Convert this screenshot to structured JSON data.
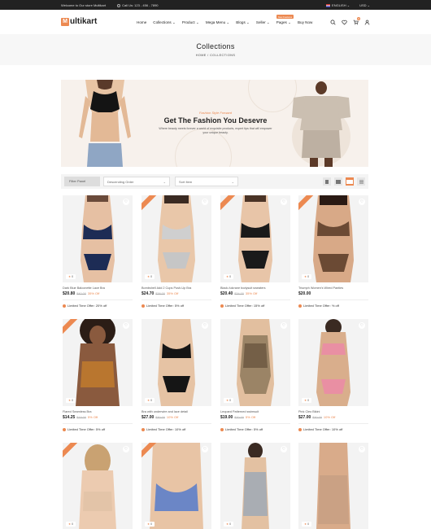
{
  "topbar": {
    "welcome": "Welcome to Our store Multikart",
    "phone": "Call Us: 123 - 456 - 7890",
    "language": "ENGLISH",
    "currency": "USD"
  },
  "header": {
    "logo_initial": "M",
    "logo_text": "ultikart",
    "nav": [
      "Home",
      "Collections",
      "Product",
      "Mega Menu",
      "Blogs",
      "Seller",
      "Pages",
      "Buy Now"
    ],
    "new_badge": "New Features",
    "cart_count": "0"
  },
  "page": {
    "title": "Collections",
    "breadcrumb": "HOME / COLLECTIONS"
  },
  "banner": {
    "tag": "Fashion Style Forward",
    "heading": "Get The Fashion You Desevre",
    "text": "Where beauty meets forever a world of exquisite products, expert tips that will empower your unique beauty."
  },
  "filters": {
    "filter_panel": "Filter Panel",
    "sort": "Descending Order",
    "items": "Sort Item"
  },
  "colors": {
    "accent": "#ec8951",
    "dark": "#222222"
  },
  "products": [
    {
      "name": "Dark Blue Balconette Lace Bra",
      "price": "$20.80",
      "old": "$40.00",
      "off": "35% Off",
      "offer": "Limited Time Offer: 20% off",
      "rating": "0",
      "sale": false
    },
    {
      "name": "Bombshell Add 2 Cups Push-Up Bra",
      "price": "$24.70",
      "old": "$38.00",
      "off": "35% Off",
      "offer": "Limited Time Offer: 5% off",
      "rating": "0",
      "sale": true
    },
    {
      "name": "Black-fulcrane bodysuit sweaters",
      "price": "$20.40",
      "old": "$34.00",
      "off": "35% Off",
      "offer": "Limited Time Offer: 15% off",
      "rating": "0",
      "sale": true
    },
    {
      "name": "Triumph Women's Wired Panties",
      "price": "$20.00",
      "old": "",
      "off": "",
      "offer": "Limited Time Offer: % off",
      "rating": "0",
      "sale": true
    },
    {
      "name": "Flared Seamless Bra",
      "price": "$14.25",
      "old": "$19.00",
      "off": "5% Off",
      "offer": "Limited Time Offer: 5% off",
      "rating": "0",
      "sale": true
    },
    {
      "name": "Bra with underwire and lace detail",
      "price": "$27.00",
      "old": "$30.00",
      "off": "10% Off",
      "offer": "Limited Time Offer: 10% off",
      "rating": "0",
      "sale": false
    },
    {
      "name": "Leopard Patterned swimsuit",
      "price": "$19.00",
      "old": "$20.00",
      "off": "5% Off",
      "offer": "Limited Time Offer: 5% off",
      "rating": "0",
      "sale": false
    },
    {
      "name": "Pink Cleo Bikini",
      "price": "$27.00",
      "old": "$30.00",
      "off": "10% Off",
      "offer": "Limited Time Offer: 10% off",
      "rating": "0",
      "sale": false
    },
    {
      "name": "",
      "price": "",
      "old": "",
      "off": "",
      "offer": "",
      "rating": "0",
      "sale": true
    },
    {
      "name": "",
      "price": "",
      "old": "",
      "off": "",
      "offer": "",
      "rating": "0",
      "sale": true
    },
    {
      "name": "",
      "price": "",
      "old": "",
      "off": "",
      "offer": "",
      "rating": "0",
      "sale": false
    },
    {
      "name": "",
      "price": "",
      "old": "",
      "off": "",
      "offer": "",
      "rating": "0",
      "sale": false
    }
  ]
}
